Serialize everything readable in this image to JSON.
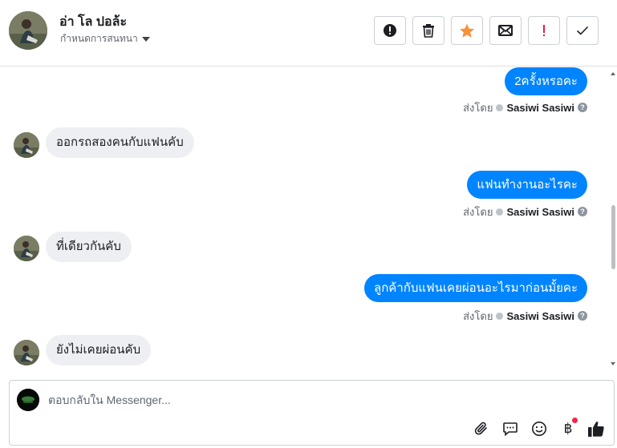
{
  "header": {
    "contact_name": "อ่า โล ปอล้ะ",
    "assign_label": "กำหนดการสนทนา",
    "tools": [
      {
        "name": "mark-spam",
        "icon": "alert-circle-icon"
      },
      {
        "name": "delete",
        "icon": "trash-icon"
      },
      {
        "name": "star",
        "icon": "star-icon",
        "color": "#f7923b"
      },
      {
        "name": "mark-unread",
        "icon": "envelope-icon"
      },
      {
        "name": "follow-up",
        "icon": "exclamation-icon",
        "color": "#e41e3f"
      },
      {
        "name": "mark-done",
        "icon": "check-icon"
      }
    ]
  },
  "messages": [
    {
      "direction": "out",
      "text": "2ครั้งหรอคะ",
      "sent_by_label": "ส่งโดย",
      "sender": "Sasiwi Sasiwi"
    },
    {
      "direction": "in",
      "text": "ออกรถสองคนกับแฟนคับ"
    },
    {
      "direction": "out",
      "text": "แฟนทำงานอะไรคะ",
      "sent_by_label": "ส่งโดย",
      "sender": "Sasiwi Sasiwi"
    },
    {
      "direction": "in",
      "text": "ที่เดียวกันคับ"
    },
    {
      "direction": "out",
      "text": "ลูกค้ากับแฟนเคยผ่อนอะไรมาก่อนมั้ยคะ",
      "sent_by_label": "ส่งโดย",
      "sender": "Sasiwi Sasiwi"
    },
    {
      "direction": "in",
      "text": "ยังไม่เคยผ่อนคับ"
    }
  ],
  "composer": {
    "placeholder": "ตอบกลับใน Messenger...",
    "value": "",
    "currency_symbol": "฿"
  },
  "colors": {
    "outgoing_bubble": "#0084ff",
    "incoming_bubble": "#eeeff2",
    "notification_dot": "#f02849"
  }
}
